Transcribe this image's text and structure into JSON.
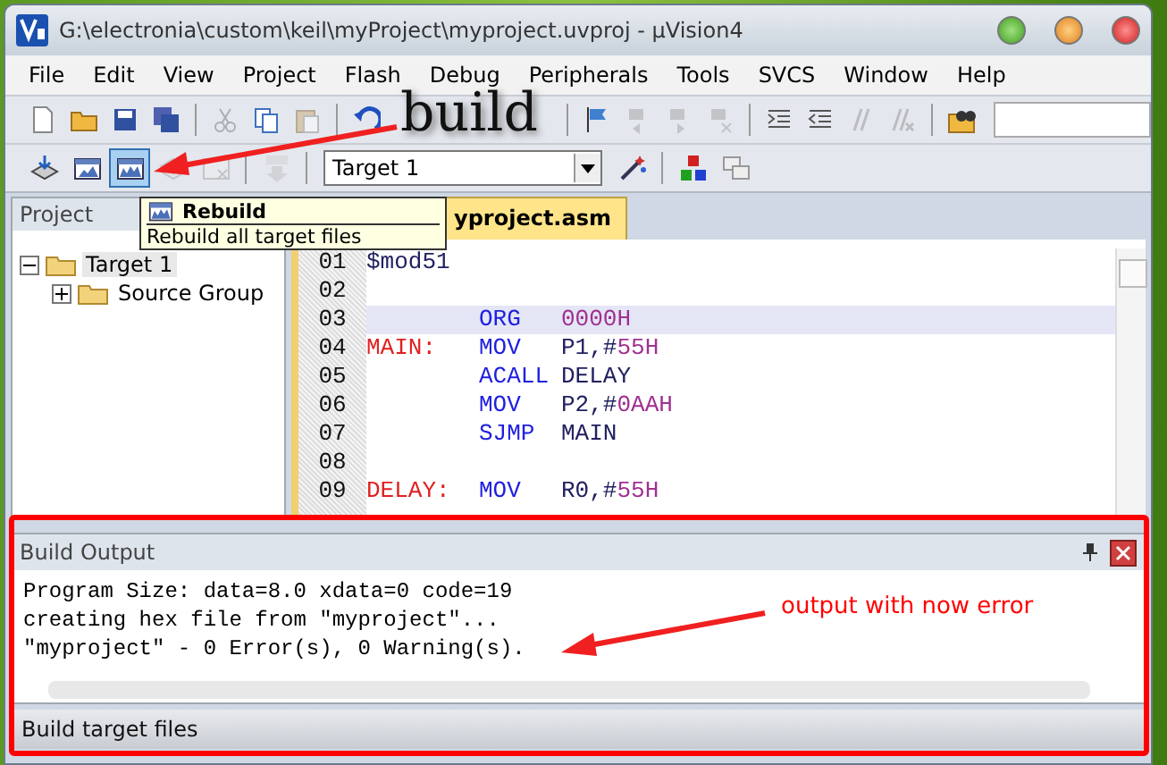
{
  "window": {
    "title": "G:\\electronia\\custom\\keil\\myProject\\myproject.uvproj - µVision4"
  },
  "menu": [
    "File",
    "Edit",
    "View",
    "Project",
    "Flash",
    "Debug",
    "Peripherals",
    "Tools",
    "SVCS",
    "Window",
    "Help"
  ],
  "toolbar_1": [
    {
      "kind": "new",
      "disabled": false
    },
    {
      "kind": "open",
      "disabled": false
    },
    {
      "kind": "save",
      "disabled": false
    },
    {
      "kind": "save-all",
      "disabled": false
    },
    {
      "kind": "sep"
    },
    {
      "kind": "cut",
      "disabled": true
    },
    {
      "kind": "copy",
      "disabled": false
    },
    {
      "kind": "paste",
      "disabled": true
    },
    {
      "kind": "sep"
    },
    {
      "kind": "undo",
      "disabled": false
    },
    {
      "kind": "gap"
    },
    {
      "kind": "sep"
    },
    {
      "kind": "bookmark",
      "disabled": false
    },
    {
      "kind": "prev-bookmark",
      "disabled": true
    },
    {
      "kind": "next-bookmark",
      "disabled": true
    },
    {
      "kind": "clear-bookmarks",
      "disabled": true
    },
    {
      "kind": "sep"
    },
    {
      "kind": "indent",
      "disabled": false
    },
    {
      "kind": "unindent",
      "disabled": false
    },
    {
      "kind": "comment",
      "disabled": true
    },
    {
      "kind": "uncomment",
      "disabled": true
    },
    {
      "kind": "sep"
    },
    {
      "kind": "find-in-files",
      "disabled": false
    }
  ],
  "toolbar_2": [
    {
      "kind": "translate",
      "disabled": false,
      "selected": false
    },
    {
      "kind": "build",
      "disabled": false,
      "selected": false
    },
    {
      "kind": "rebuild",
      "disabled": false,
      "selected": true
    },
    {
      "kind": "batch",
      "disabled": true,
      "selected": false
    },
    {
      "kind": "stop",
      "disabled": true,
      "selected": false
    },
    {
      "kind": "sep"
    },
    {
      "kind": "download",
      "disabled": true,
      "selected": false
    },
    {
      "kind": "sep"
    },
    {
      "kind": "target"
    },
    {
      "kind": "options",
      "disabled": false,
      "selected": false
    },
    {
      "kind": "sep"
    },
    {
      "kind": "manage",
      "disabled": false,
      "selected": false
    },
    {
      "kind": "window",
      "disabled": false,
      "selected": false
    }
  ],
  "target_select": {
    "value": "Target 1"
  },
  "project_panel": {
    "title": "Project",
    "tree": [
      {
        "label": "Target 1",
        "expanded": true,
        "selected": true,
        "children": [
          {
            "label": "Source Group",
            "expanded": false,
            "selected": false
          }
        ]
      }
    ]
  },
  "editor": {
    "tabs": [
      {
        "label": "yproject.asm",
        "selected": true
      }
    ],
    "lines": [
      {
        "number": "01",
        "current": false,
        "args": [
          {
            "kind": "text",
            "text": "$mod51"
          }
        ]
      },
      {
        "number": "02",
        "current": false
      },
      {
        "number": "03",
        "current": true,
        "op": "ORG",
        "args": [
          {
            "kind": "number",
            "text": "0000H"
          }
        ]
      },
      {
        "number": "04",
        "current": false,
        "label": "MAIN:",
        "op": "MOV",
        "args": [
          {
            "kind": "text",
            "text": "P1,#"
          },
          {
            "kind": "number",
            "text": "55H"
          }
        ]
      },
      {
        "number": "05",
        "current": false,
        "op": "ACALL",
        "args": [
          {
            "kind": "text",
            "text": "DELAY"
          }
        ]
      },
      {
        "number": "06",
        "current": false,
        "op": "MOV",
        "args": [
          {
            "kind": "text",
            "text": "P2,#"
          },
          {
            "kind": "number",
            "text": "0AAH"
          }
        ]
      },
      {
        "number": "07",
        "current": false,
        "op": "SJMP",
        "args": [
          {
            "kind": "text",
            "text": "MAIN"
          }
        ]
      },
      {
        "number": "08",
        "current": false
      },
      {
        "number": "09",
        "current": false,
        "label": "DELAY:",
        "op": "MOV",
        "args": [
          {
            "kind": "text",
            "text": "R0,#"
          },
          {
            "kind": "number",
            "text": "55H"
          }
        ]
      }
    ]
  },
  "tooltip": {
    "title": "Rebuild",
    "text": "Rebuild all target files"
  },
  "build_output": {
    "title": "Build Output",
    "lines": [
      "Program Size: data=8.0 xdata=0 code=19",
      "creating hex file from \"myproject\"...",
      "\"myproject\" - 0 Error(s), 0 Warning(s)."
    ]
  },
  "status_bar": "Build target files",
  "annotations": [
    {
      "kind": "label",
      "text": "build"
    },
    {
      "kind": "note",
      "text": "output with now error"
    }
  ]
}
